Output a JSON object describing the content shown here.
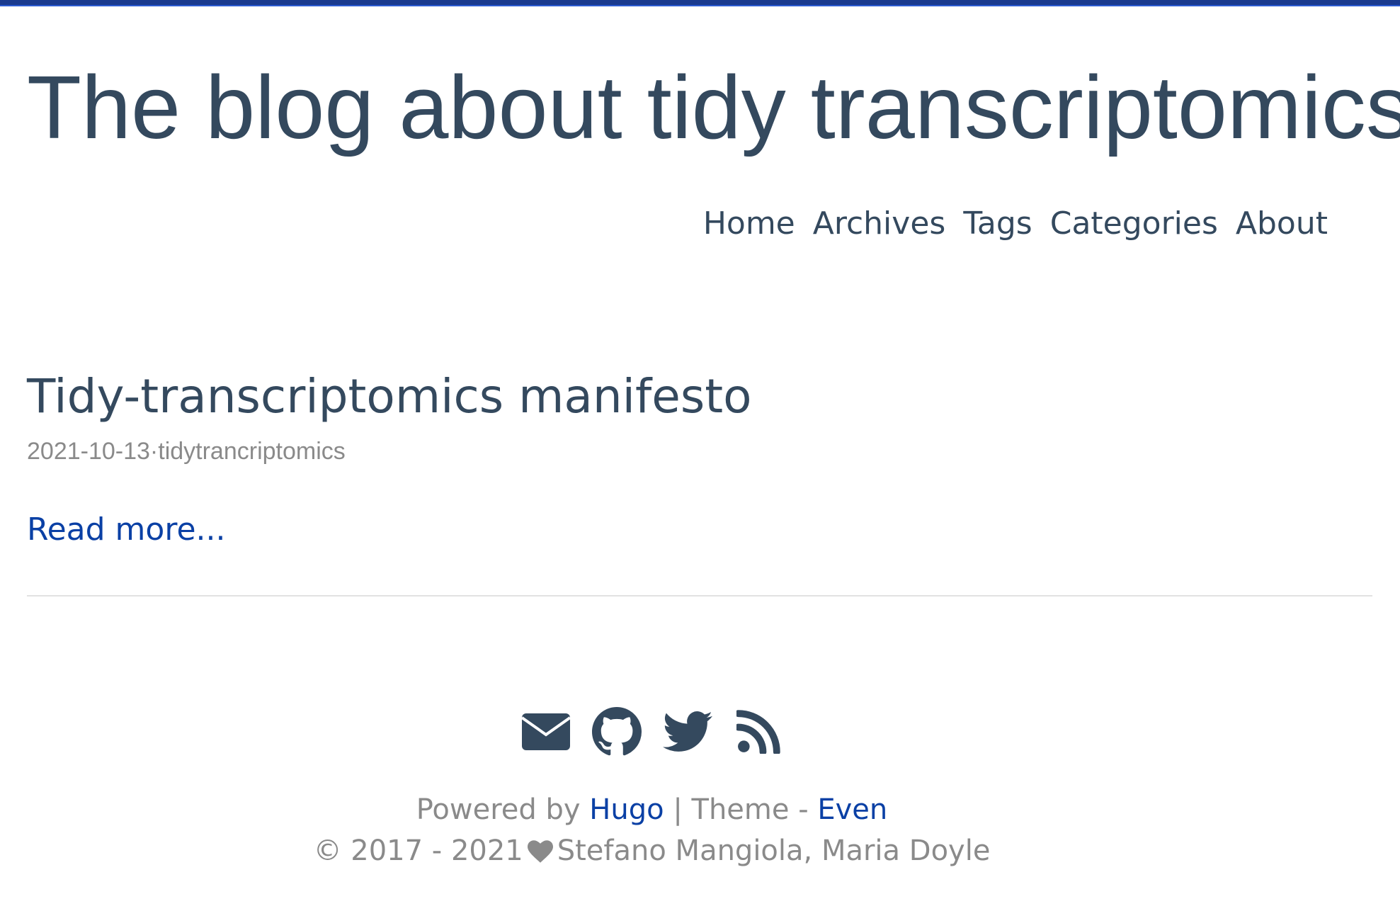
{
  "site": {
    "title": "The blog about tidy transcriptomics"
  },
  "nav": {
    "items": [
      {
        "label": "Home"
      },
      {
        "label": "Archives"
      },
      {
        "label": "Tags"
      },
      {
        "label": "Categories"
      },
      {
        "label": "About"
      }
    ]
  },
  "post": {
    "title": "Tidy-transcriptomics manifesto",
    "date": "2021-10-13",
    "separator": "·",
    "category": "tidytrancriptomics",
    "read_more": "Read more..."
  },
  "footer": {
    "social_icons": [
      "email-icon",
      "github-icon",
      "twitter-icon",
      "rss-icon"
    ],
    "powered_by": "Powered by",
    "hugo": "Hugo",
    "theme_sep": "| Theme -",
    "even": "Even",
    "copyright": "© 2017 - 2021",
    "authors": "Stefano Mangiola, Maria Doyle"
  },
  "colors": {
    "heading": "#34495e",
    "link": "#0a40a5",
    "muted": "#8a8a8a",
    "top_bar": "#1a3a8f"
  }
}
